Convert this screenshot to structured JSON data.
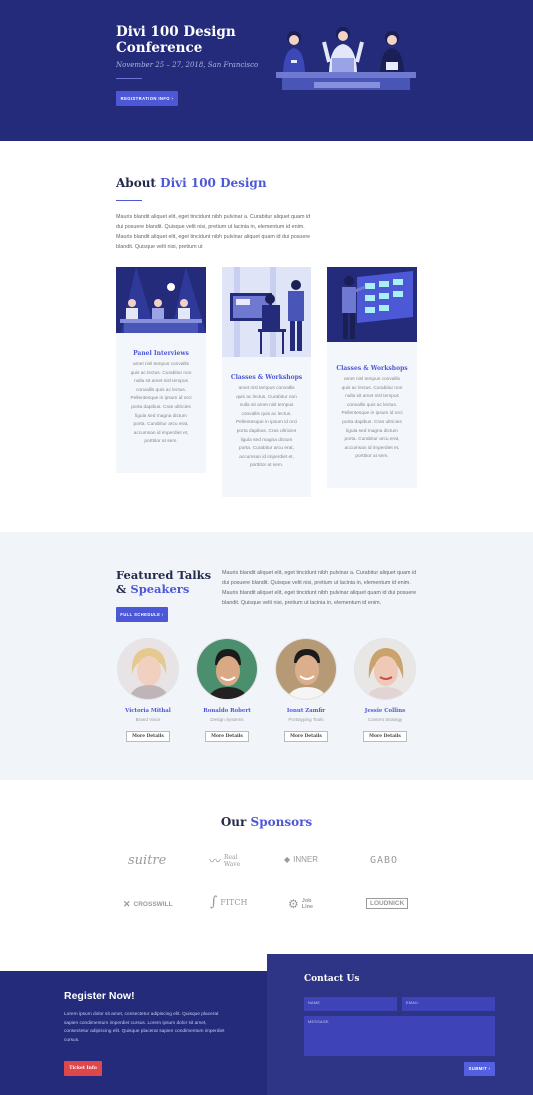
{
  "hero": {
    "title": "Divi 100 Design Conference",
    "date": "November 25 – 27, 2018, San Francisco",
    "button": "REGISTRATION INFO",
    "button_icon": "›"
  },
  "about": {
    "title_prefix": "About",
    "title_highlight": "Divi 100 Design",
    "paragraph": "Mauris blandit aliquet elit, eget tincidunt nibh pulvinar a. Curabitur aliquet quam id dui posuere blandit. Quisque velit nisi, pretium ut lacinia in, elementum id enim. Mauris blandit aliquet elit, eget tincidunt nibh pulvinar aliquet quam id dui posuere blandit. Quisque velit nisi, pretium ut",
    "cards": [
      {
        "title": "Panel Interviews",
        "text": "amet nisl tempus convallis quis ac lectus. Curabitur non nulla sit amet nisl tempus convallis quis ac lectus. Pellentesque in ipsum id orci porta dapibus. Cras ultricies ligula sed magna dictum porta. Curabitur arcu erat, accumsan id imperdiet et, porttitor at sem."
      },
      {
        "title": "Classes & Workshops",
        "text": "amet nisl tempus convallis quis ac lectus. Curabitur non nulla sit amet nisl tempus convallis quis ac lectus. Pellentesque in ipsum id orci porta dapibus. Cras ultricies ligula sed magna dictum porta. Curabitur arcu erat, accumsan id imperdiet et, porttitor at sem."
      },
      {
        "title": "Classes & Workshops",
        "text": "amet nisl tempus convallis quis ac lectus. Curabitur non nulla sit amet nisl tempus convallis quis ac lectus. Pellentesque in ipsum id orci porta dapibus. Cras ultricies ligula sed magna dictum porta. Curabitur arcu erat, accumsan id imperdiet et, porttitor at sem."
      }
    ]
  },
  "featured": {
    "title_line1": "Featured Talks",
    "title_amp": "& ",
    "title_highlight": "Speakers",
    "button": "FULL SCHEDULE",
    "button_icon": "›",
    "paragraph": "Mauris blandit aliquet elit, eget tincidunt nibh pulvinar a. Curabitur aliquet quam id dui posuere blandit. Quisque velit nisi, pretium ut lacinia in, elementum id enim. Mauris blandit aliquet elit, eget tincidunt nibh pulvinar aliquet quam id dui posuere blandit. Quisque velit nisi, pretium ut lacinia in, elementum id enim.",
    "speakers": [
      {
        "name": "Victoria Mithal",
        "role": "Brand Voice",
        "button": "More Details"
      },
      {
        "name": "Ronaldo Robert",
        "role": "Design Systems",
        "button": "More Details"
      },
      {
        "name": "Ionut Zamfir",
        "role": "Prototyping Tools",
        "button": "More Details"
      },
      {
        "name": "Jessie Collins",
        "role": "Content Strategy",
        "button": "More Details"
      }
    ]
  },
  "sponsors": {
    "title_prefix": "Our",
    "title_highlight": "Sponsors",
    "logos": [
      "suitre",
      "Real Wave",
      "INNER",
      "GABO",
      "CROSSWILL",
      "FITCH",
      "Job Line",
      "LOUDNICK"
    ]
  },
  "register": {
    "title": "Register Now!",
    "text": "Lorem ipsum dolor sit amet, consectetur adipiscing elit. Quisque placerat sapien condimentum imperdiet cursus. Lorem ipsum dolor sit amet, consectetur adipiscing elit. Quisque placerat sapien condimentum imperdiet cursus.",
    "button": "Ticket Info"
  },
  "contact": {
    "title": "Contact Us",
    "name_placeholder": "NAME",
    "email_placeholder": "EMAIL",
    "message_placeholder": "MESSAGE",
    "submit": "SUBMIT",
    "submit_icon": "›"
  },
  "colors": {
    "primary_dark": "#232b7a",
    "accent": "#4d58d6",
    "light_bg": "#f1f5fa",
    "ticket": "#e0474c"
  }
}
